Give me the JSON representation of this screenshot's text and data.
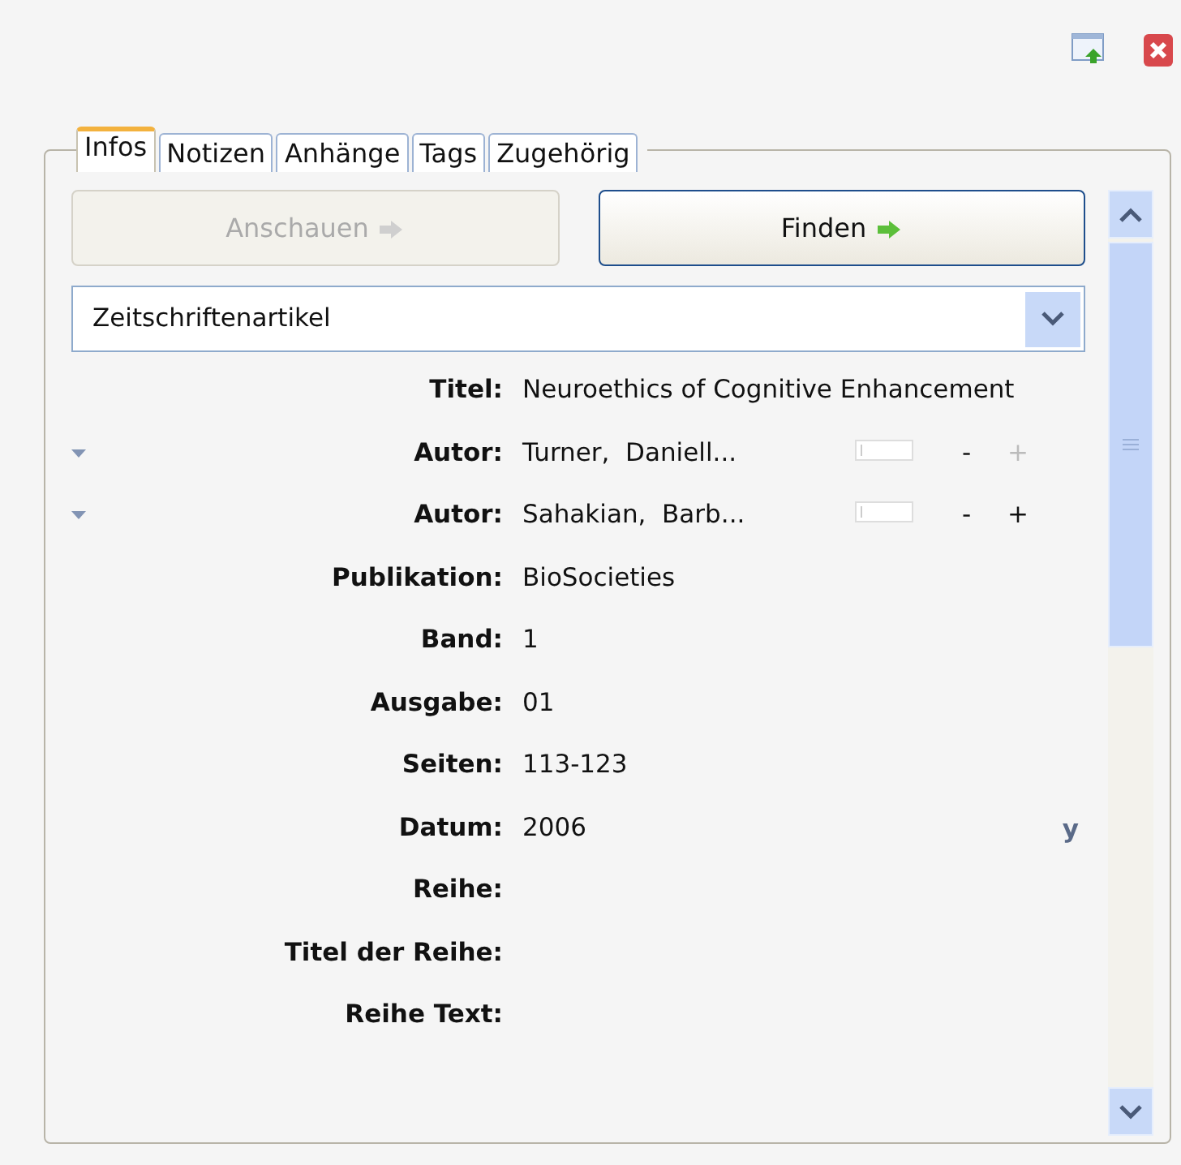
{
  "tabs": [
    {
      "label": "Infos",
      "selected": true
    },
    {
      "label": "Notizen",
      "selected": false
    },
    {
      "label": "Anhänge",
      "selected": false
    },
    {
      "label": "Tags",
      "selected": false
    },
    {
      "label": "Zugehörig",
      "selected": false
    }
  ],
  "buttons": [
    {
      "label": "Anschauen",
      "disabled": true
    },
    {
      "label": "Finden",
      "disabled": false
    }
  ],
  "item_type": {
    "value": "Zeitschriftenartikel"
  },
  "fields": [
    {
      "kind": "text",
      "label": "Titel:",
      "value": "Neuroethics of Cognitive Enhancement"
    },
    {
      "kind": "creator",
      "label": "Autor:",
      "last": "Turner,",
      "first": "Daniell...",
      "minus": "-",
      "plus": "+",
      "plus_disabled": true
    },
    {
      "kind": "creator",
      "label": "Autor:",
      "last": "Sahakian,",
      "first": "Barb...",
      "minus": "-",
      "plus": "+",
      "plus_disabled": false
    },
    {
      "kind": "text",
      "label": "Publikation:",
      "value": "BioSocieties"
    },
    {
      "kind": "text",
      "label": "Band:",
      "value": "1"
    },
    {
      "kind": "text",
      "label": "Ausgabe:",
      "value": "01"
    },
    {
      "kind": "text",
      "label": "Seiten:",
      "value": "113-123"
    },
    {
      "kind": "date",
      "label": "Datum:",
      "value": "2006",
      "marker": "y"
    },
    {
      "kind": "text",
      "label": "Reihe:"
    },
    {
      "kind": "text",
      "label": "Titel der Reihe:"
    },
    {
      "kind": "text",
      "label": "Reihe Text:"
    }
  ]
}
